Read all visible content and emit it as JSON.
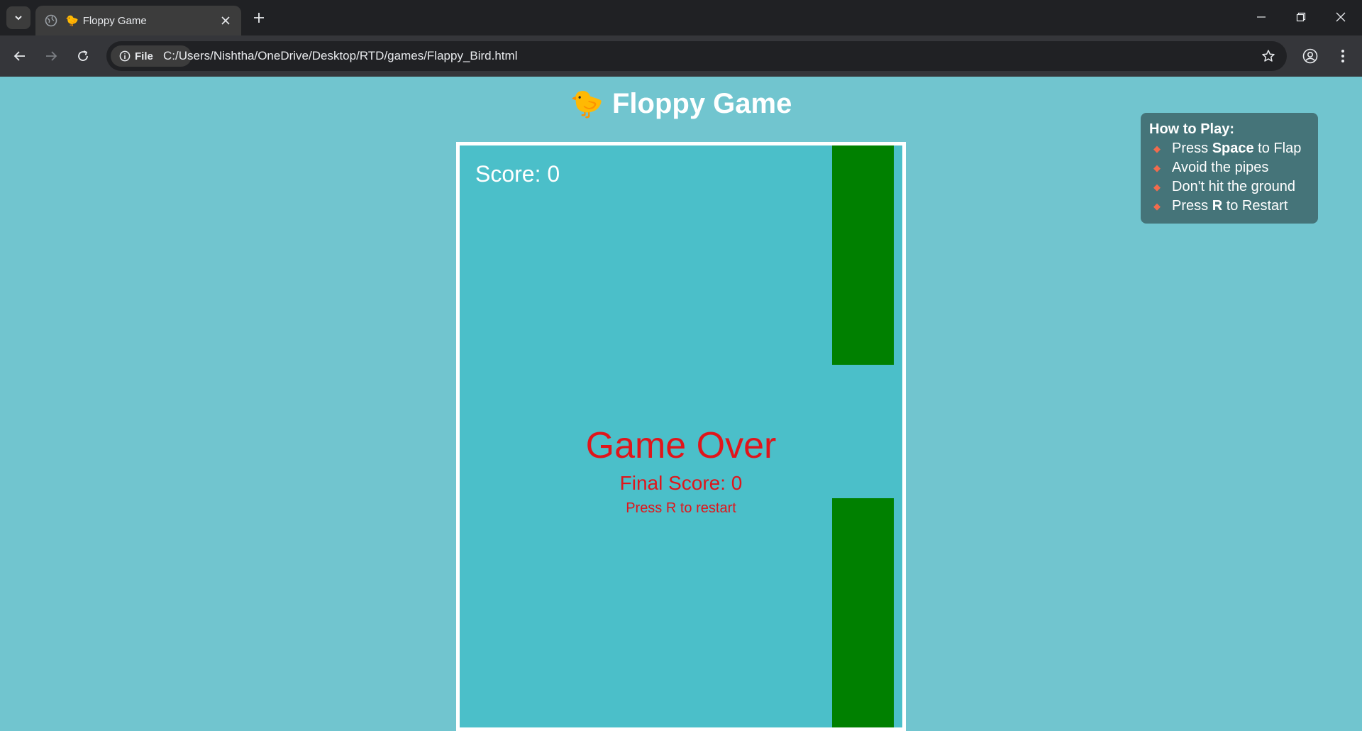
{
  "browser": {
    "tab_title": "Floppy Game",
    "tab_favicon": "🐤",
    "address_chip": "File",
    "url": "C:/Users/Nishtha/OneDrive/Desktop/RTD/games/Flappy_Bird.html"
  },
  "page": {
    "title_emoji": "🐤",
    "title": "Floppy Game",
    "background": "#71c5cf"
  },
  "howto": {
    "heading": "How to Play:",
    "items": [
      {
        "pre": "Press ",
        "bold": "Space",
        "post": " to Flap"
      },
      {
        "pre": "Avoid the pipes",
        "bold": "",
        "post": ""
      },
      {
        "pre": "Don't hit the ground",
        "bold": "",
        "post": ""
      },
      {
        "pre": "Press ",
        "bold": "R",
        "post": " to Restart"
      }
    ],
    "bullet": "◆"
  },
  "game": {
    "score_text": "Score: 0",
    "game_over": "Game Over",
    "final_score": "Final Score: 0",
    "restart_hint": "Press R to restart",
    "sky_color": "#4bbfc9",
    "pipe_color": "#008000",
    "text_color": "#e0151b"
  }
}
